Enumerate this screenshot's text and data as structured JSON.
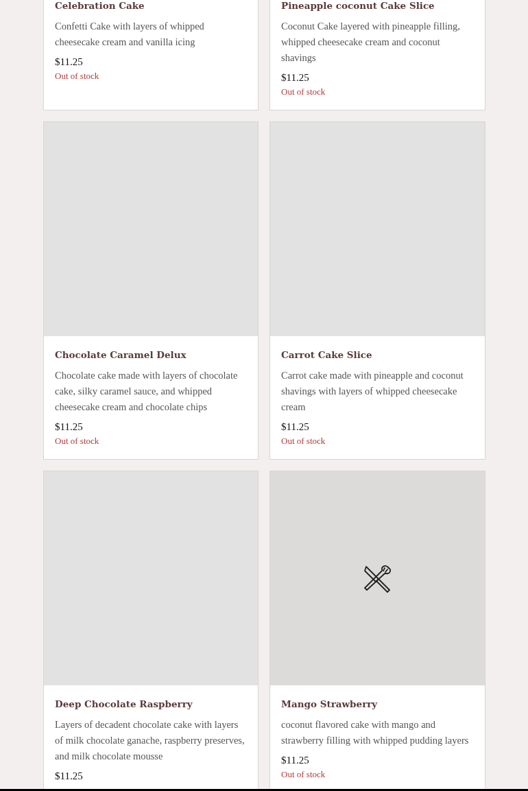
{
  "products": [
    {
      "name": "Celebration Cake",
      "description": "Confetti Cake with layers of whipped cheesecake cream and vanilla icing",
      "price": "$11.25",
      "stock": "Out of stock"
    },
    {
      "name": "Pineapple coconut Cake Slice",
      "description": "Coconut Cake layered with pineapple filling, whipped cheesecake cream and coconut shavings",
      "price": "$11.25",
      "stock": "Out of stock"
    },
    {
      "image": {
        "kind": "blank"
      },
      "name": "Chocolate Caramel Delux",
      "description": "Chocolate cake made with layers of chocolate cake, silky caramel sauce, and whipped cheesecake cream and chocolate chips",
      "price": "$11.25",
      "stock": "Out of stock"
    },
    {
      "image": {
        "kind": "blank"
      },
      "name": "Carrot Cake Slice",
      "description": "Carrot cake made with pineapple and coconut shavings with layers of whipped cheesecake cream",
      "price": "$11.25",
      "stock": "Out of stock"
    },
    {
      "image": {
        "kind": "blank"
      },
      "name": "Deep Chocolate Raspberry",
      "description": "Layers of decadent chocolate cake with layers of milk chocolate ganache, raspberry preserves, and milk chocolate mousse",
      "price": "$11.25"
    },
    {
      "image": {
        "kind": "no-photo"
      },
      "name": "Mango Strawberry",
      "description": "coconut flavored cake with mango and strawberry filling with whipped pudding layers",
      "price": "$11.25",
      "stock": "Out of stock"
    }
  ]
}
